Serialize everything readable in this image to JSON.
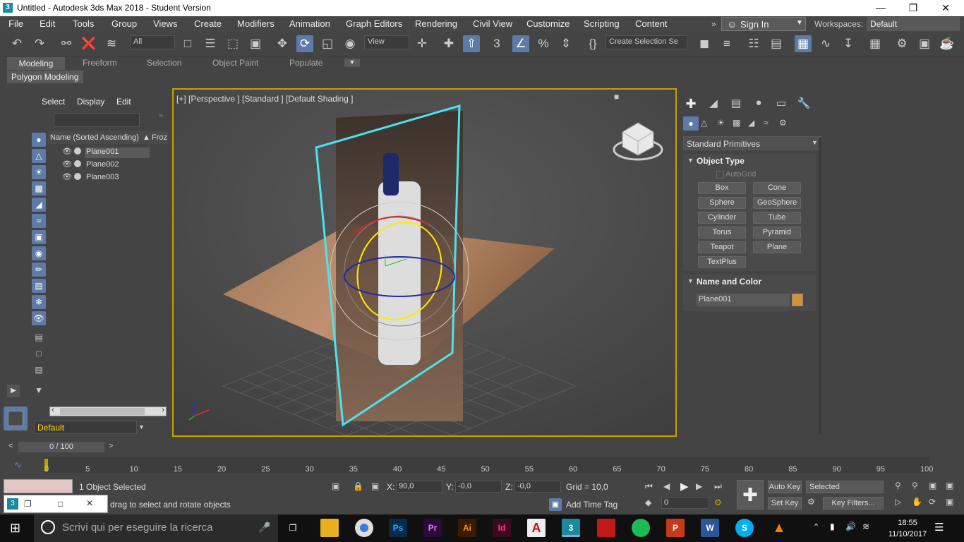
{
  "window": {
    "title": "Untitled - Autodesk 3ds Max 2018 - Student Version",
    "app_icon": "3"
  },
  "menu": [
    "File",
    "Edit",
    "Tools",
    "Group",
    "Views",
    "Create",
    "Modifiers",
    "Animation",
    "Graph Editors",
    "Rendering",
    "Civil View",
    "Customize",
    "Scripting",
    "Content"
  ],
  "signin": "Sign In",
  "workspaces": {
    "label": "Workspaces:",
    "value": "Default"
  },
  "toolbar": {
    "filter": "All",
    "refcoord": "View",
    "selection_set": "Create Selection Se"
  },
  "ribbon": {
    "tabs": [
      "Modeling",
      "Freeform",
      "Selection",
      "Object Paint",
      "Populate"
    ],
    "panel": "Polygon Modeling"
  },
  "scene_explorer": {
    "tabs": [
      "Select",
      "Display",
      "Edit"
    ],
    "column": "Name (Sorted Ascending)",
    "column2": "Froz",
    "rows": [
      "Plane001",
      "Plane002",
      "Plane003"
    ],
    "layer": "Default"
  },
  "viewport": {
    "label": "[+] [Perspective ] [Standard ] [Default Shading ]"
  },
  "command_panel": {
    "category": "Standard Primitives",
    "object_type": {
      "title": "Object Type",
      "autogrid": "AutoGrid",
      "buttons": [
        "Box",
        "Cone",
        "Sphere",
        "GeoSphere",
        "Cylinder",
        "Tube",
        "Torus",
        "Pyramid",
        "Teapot",
        "Plane",
        "TextPlus"
      ]
    },
    "name_color": {
      "title": "Name and Color",
      "name": "Plane001",
      "color": "#d49238"
    }
  },
  "timeline": {
    "slider": "0 / 100",
    "ticks": [
      "0",
      "5",
      "10",
      "15",
      "20",
      "25",
      "30",
      "35",
      "40",
      "45",
      "50",
      "55",
      "60",
      "65",
      "70",
      "75",
      "80",
      "85",
      "90",
      "95",
      "100"
    ]
  },
  "status": {
    "selected": "1 Object Selected",
    "prompt": "drag to select and rotate objects",
    "x_label": "X:",
    "x": "90,0",
    "y_label": "Y:",
    "y": "-0,0",
    "z_label": "Z:",
    "z": "-0,0",
    "grid": "Grid = 10,0",
    "add_time_tag": "Add Time Tag",
    "auto_key": "Auto Key",
    "set_key": "Set Key",
    "key_mode": "Selected",
    "key_filters": "Key Filters...",
    "frame": "0"
  },
  "taskbar": {
    "search": "Scrivi qui per eseguire la ricerca",
    "time": "18:55",
    "date": "11/10/2017",
    "apps": [
      "Ps",
      "Pr",
      "Ai",
      "Id",
      "3"
    ]
  }
}
